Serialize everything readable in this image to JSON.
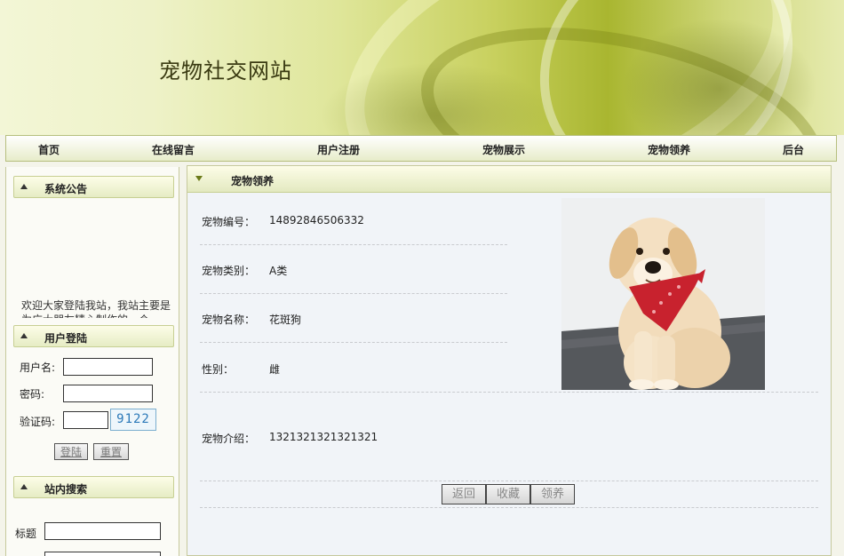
{
  "header": {
    "site_title": "宠物社交网站"
  },
  "nav": {
    "items": [
      "首页",
      "在线留言",
      "用户注册",
      "宠物展示",
      "宠物领养",
      "后台"
    ]
  },
  "sidebar": {
    "notice": {
      "title": "系统公告",
      "text": "欢迎大家登陆我站，我站主要是为广大朋友精心制作的一个"
    },
    "login": {
      "title": "用户登陆",
      "username_label": "用户名:",
      "username_value": "",
      "password_label": "密码:",
      "password_value": "",
      "captcha_label": "验证码:",
      "captcha_value": "",
      "captcha_code": "9122",
      "login_button": "登陆",
      "reset_button": "重置"
    },
    "search": {
      "title": "站内搜索",
      "title_label": "标题",
      "title_value": ""
    }
  },
  "main": {
    "section_title": "宠物领养",
    "fields": [
      {
        "label": "宠物编号：",
        "value": "14892846506332"
      },
      {
        "label": "宠物类别：",
        "value": "A类"
      },
      {
        "label": "宠物名称：",
        "value": "花斑狗"
      },
      {
        "label": "性别：",
        "value": "雌"
      },
      {
        "label": "宠物介绍：",
        "value": "1321321321321321"
      }
    ],
    "actions": {
      "back": "返回",
      "favorite": "收藏",
      "adopt": "领养"
    }
  },
  "colors": {
    "accent": "#c9d160",
    "nav_border": "#b6bf7e",
    "captcha_text": "#2a78b8",
    "bandana": "#c8222e"
  }
}
